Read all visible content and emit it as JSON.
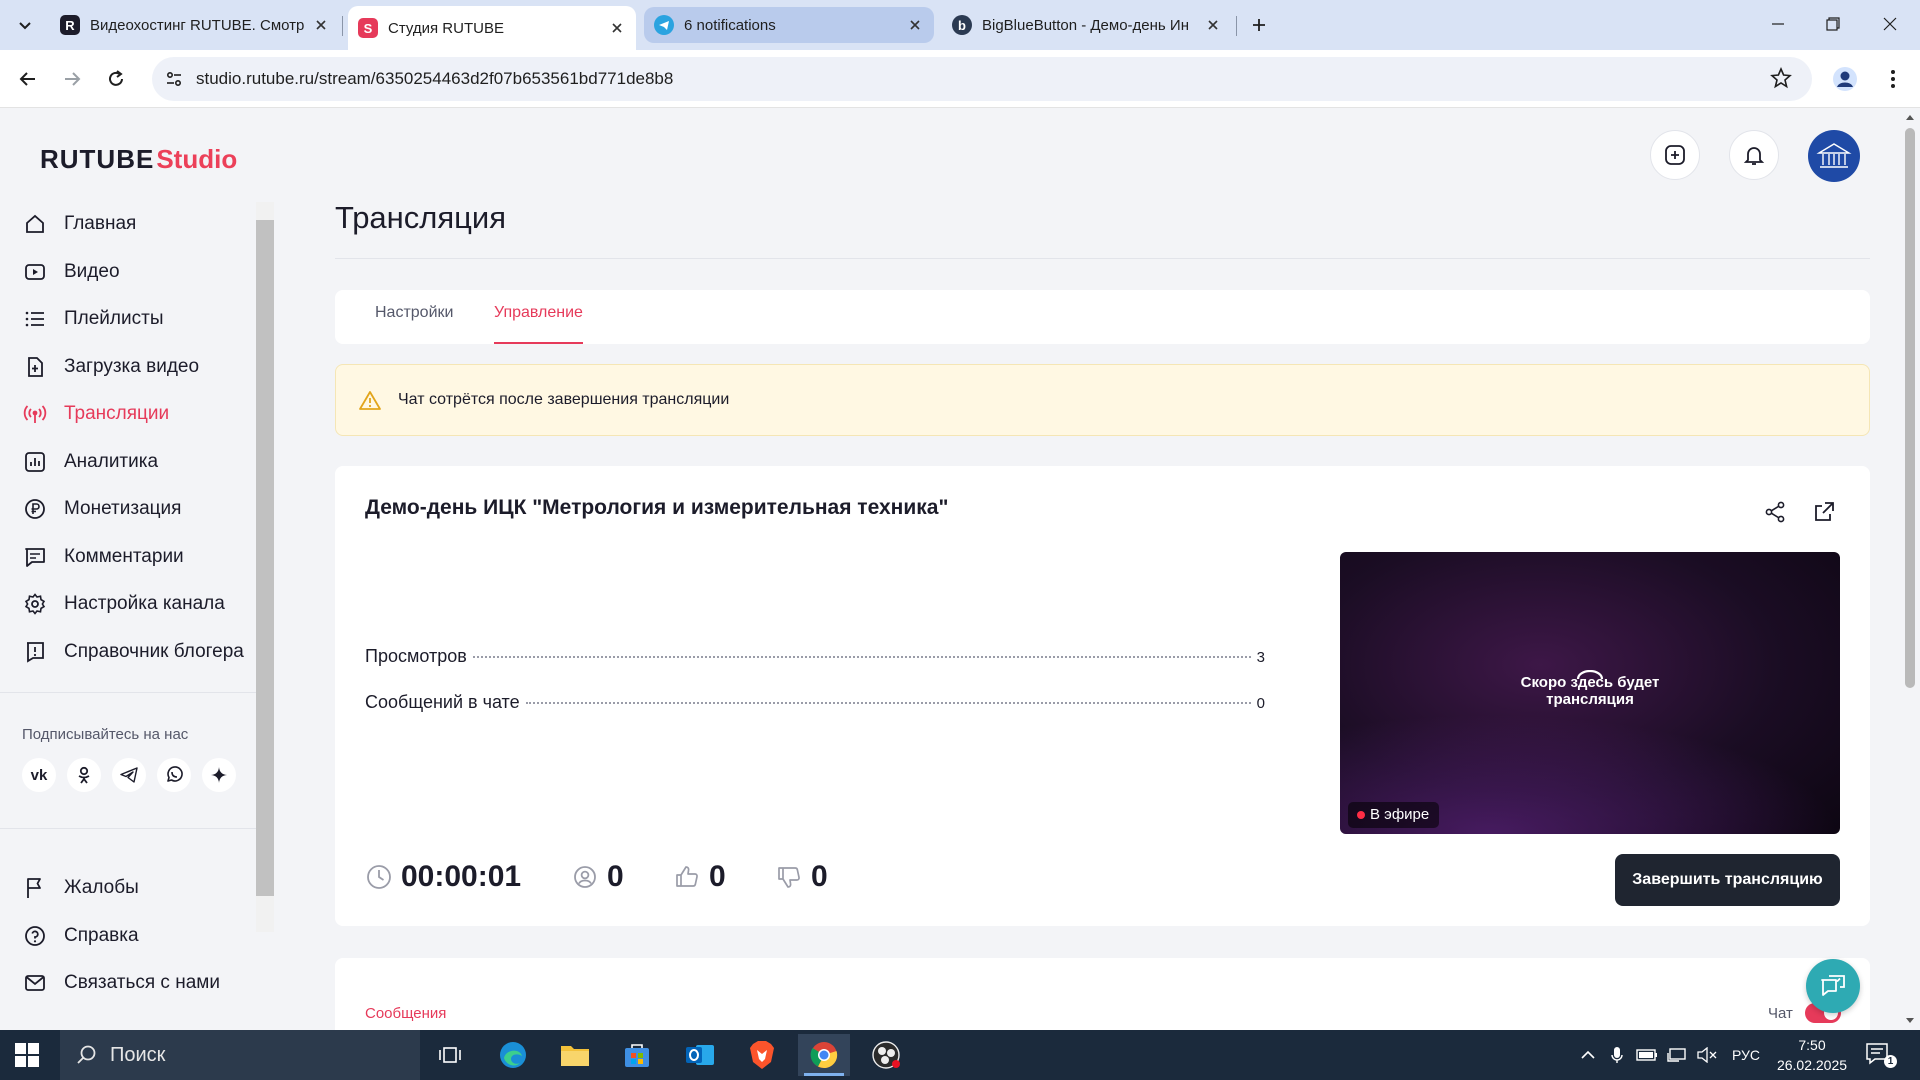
{
  "browser": {
    "tabs": [
      {
        "title": "Видеохостинг RUTUBE. Смотри",
        "favicon_letter": "R",
        "favicon_color": "#1c1c2a"
      },
      {
        "title": "Студия RUTUBE",
        "favicon_letter": "S",
        "favicon_color": "#e63a5a"
      },
      {
        "title": "6 notifications",
        "favicon_letter": "",
        "favicon_color": "#2aa3e0"
      },
      {
        "title": "BigBlueButton - Демо-день Ин",
        "favicon_letter": "b",
        "favicon_color": "#2b3a52"
      }
    ],
    "active_tab_index": 1,
    "url": "studio.rutube.ru/stream/6350254463d2f07b653561bd771de8b8"
  },
  "logo": {
    "part1": "RUTUBE",
    "part2": "Studio"
  },
  "sidebar": {
    "items": [
      {
        "label": "Главная",
        "icon": "home-icon"
      },
      {
        "label": "Видео",
        "icon": "video-icon"
      },
      {
        "label": "Плейлисты",
        "icon": "playlist-icon"
      },
      {
        "label": "Загрузка видео",
        "icon": "upload-icon"
      },
      {
        "label": "Трансляции",
        "icon": "broadcast-icon",
        "active": true
      },
      {
        "label": "Аналитика",
        "icon": "analytics-icon"
      },
      {
        "label": "Монетизация",
        "icon": "ruble-icon"
      },
      {
        "label": "Комментарии",
        "icon": "comment-icon"
      },
      {
        "label": "Настройка канала",
        "icon": "gear-icon"
      },
      {
        "label": "Справочник блогера",
        "icon": "info-icon"
      }
    ],
    "follow_label": "Подписывайтесь на нас",
    "socials": [
      "vk",
      "ok",
      "telegram",
      "viber",
      "zen"
    ],
    "bottom_items": [
      {
        "label": "Жалобы",
        "icon": "flag-icon"
      },
      {
        "label": "Справка",
        "icon": "help-icon"
      },
      {
        "label": "Связаться с нами",
        "icon": "mail-icon"
      }
    ]
  },
  "main": {
    "title": "Трансляция",
    "tabs": [
      {
        "label": "Настройки"
      },
      {
        "label": "Управление",
        "active": true
      }
    ],
    "warning": "Чат сотрётся после завершения трансляции",
    "stream": {
      "title": "Демо-день ИЦК \"Метрология и измерительная техника\"",
      "stats": [
        {
          "label": "Просмотров",
          "value": "3"
        },
        {
          "label": "Сообщений в чате",
          "value": "0"
        }
      ],
      "preview_text": "Скоро здесь будет трансляция",
      "live_badge": "В эфире",
      "duration": "00:00:01",
      "viewers": "0",
      "likes": "0",
      "dislikes": "0",
      "end_button": "Завершить трансляцию"
    },
    "messages_label": "Сообщения",
    "chat_label": "Чат"
  },
  "taskbar": {
    "search_placeholder": "Поиск",
    "language": "РУС",
    "time": "7:50",
    "date": "26.02.2025",
    "notification_count": "1"
  },
  "colors": {
    "accent": "#e63a5a",
    "dark_button": "#1f2530",
    "warning_bg": "#fff8e3",
    "support": "#2eaab3"
  }
}
